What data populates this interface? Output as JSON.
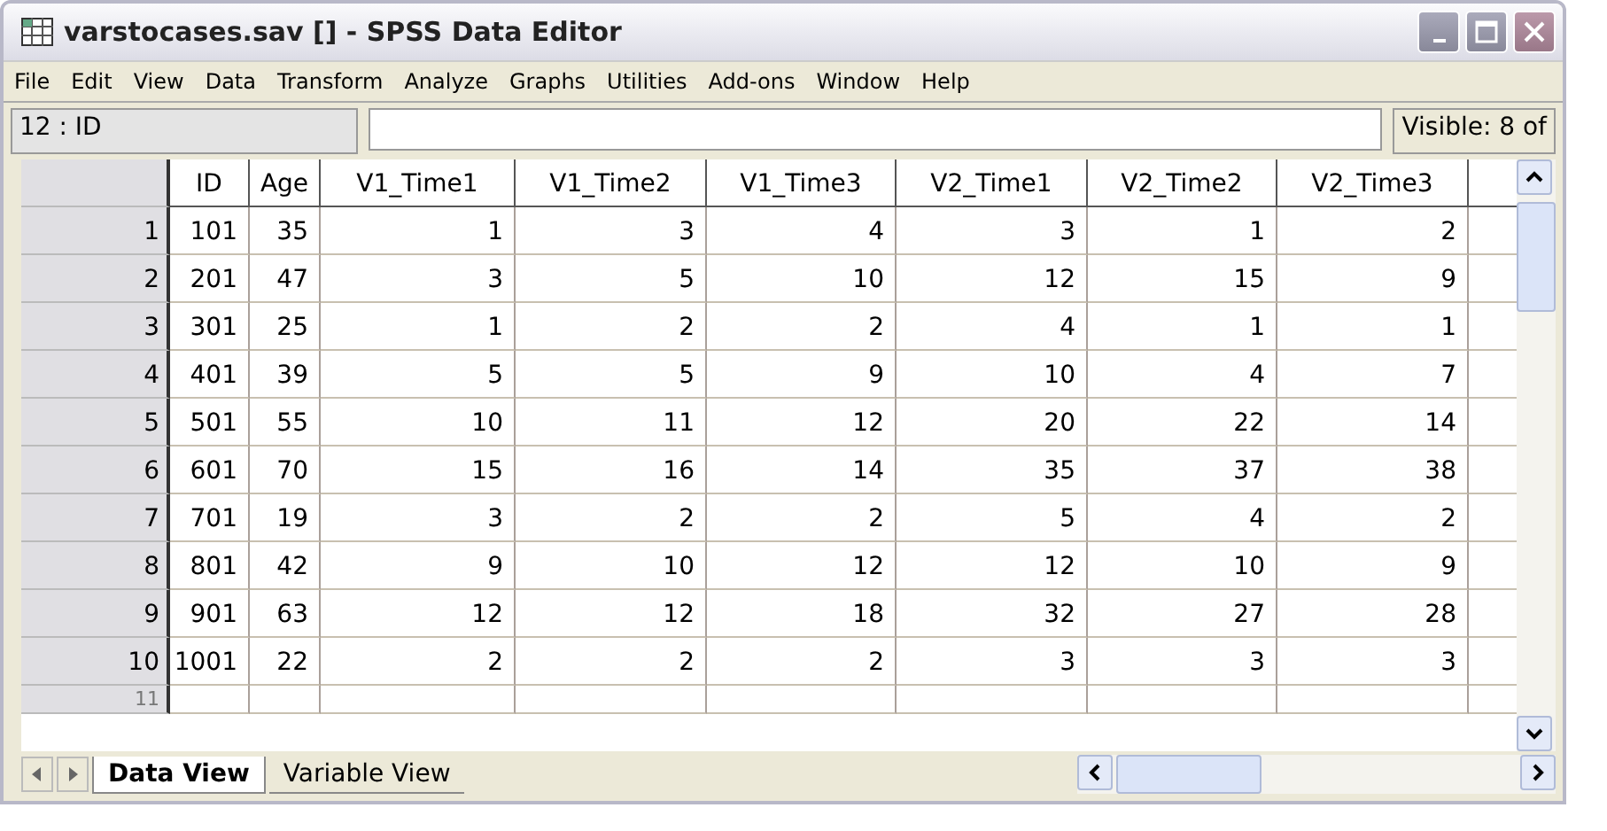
{
  "window": {
    "title": "varstocases.sav [] - SPSS Data Editor"
  },
  "menu": [
    "File",
    "Edit",
    "View",
    "Data",
    "Transform",
    "Analyze",
    "Graphs",
    "Utilities",
    "Add-ons",
    "Window",
    "Help"
  ],
  "cell_bar": {
    "reference": "12 : ID",
    "visible": "Visible: 8 of"
  },
  "table": {
    "columns": [
      "ID",
      "Age",
      "V1_Time1",
      "V1_Time2",
      "V1_Time3",
      "V2_Time1",
      "V2_Time2",
      "V2_Time3"
    ],
    "rows": [
      {
        "number": "1",
        "cells": [
          "101",
          "35",
          "1",
          "3",
          "4",
          "3",
          "1",
          "2"
        ]
      },
      {
        "number": "2",
        "cells": [
          "201",
          "47",
          "3",
          "5",
          "10",
          "12",
          "15",
          "9"
        ]
      },
      {
        "number": "3",
        "cells": [
          "301",
          "25",
          "1",
          "2",
          "2",
          "4",
          "1",
          "1"
        ]
      },
      {
        "number": "4",
        "cells": [
          "401",
          "39",
          "5",
          "5",
          "9",
          "10",
          "4",
          "7"
        ]
      },
      {
        "number": "5",
        "cells": [
          "501",
          "55",
          "10",
          "11",
          "12",
          "20",
          "22",
          "14"
        ]
      },
      {
        "number": "6",
        "cells": [
          "601",
          "70",
          "15",
          "16",
          "14",
          "35",
          "37",
          "38"
        ]
      },
      {
        "number": "7",
        "cells": [
          "701",
          "19",
          "3",
          "2",
          "2",
          "5",
          "4",
          "2"
        ]
      },
      {
        "number": "8",
        "cells": [
          "801",
          "42",
          "9",
          "10",
          "12",
          "12",
          "10",
          "9"
        ]
      },
      {
        "number": "9",
        "cells": [
          "901",
          "63",
          "12",
          "12",
          "18",
          "32",
          "27",
          "28"
        ]
      },
      {
        "number": "10",
        "cells": [
          "1001",
          "22",
          "2",
          "2",
          "2",
          "3",
          "3",
          "3"
        ]
      },
      {
        "number": "11",
        "cells": [
          "",
          "",
          "",
          "",
          "",
          "",
          "",
          ""
        ]
      }
    ]
  },
  "tabs": [
    {
      "label": "Data View",
      "selected": true
    },
    {
      "label": "Variable View",
      "selected": false
    }
  ]
}
